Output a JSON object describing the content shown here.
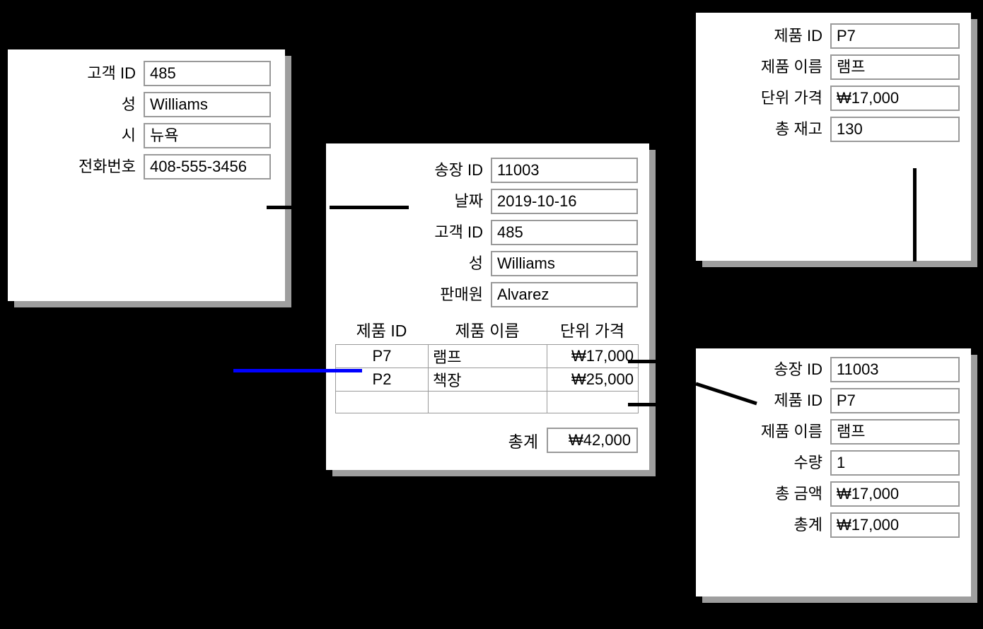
{
  "diagram": {
    "title": "Invoice relational card diagram",
    "background_color": "#000000",
    "card_color": "#ffffff",
    "shadow_color": "#9e9e9e",
    "input_border_color": "#999999",
    "connector_color": "#000000",
    "highlight_connector_color": "#0000ff"
  },
  "customer_card": {
    "name": "customer",
    "fields": [
      {
        "label": "고객 ID",
        "value": "485"
      },
      {
        "label": "성",
        "value": "Williams"
      },
      {
        "label": "시",
        "value": "뉴욕"
      },
      {
        "label": "전화번호",
        "value": "408-555-3456"
      }
    ]
  },
  "invoice_card": {
    "name": "invoice",
    "fields": [
      {
        "label": "송장 ID",
        "value": "11003"
      },
      {
        "label": "날짜",
        "value": "2019-10-16"
      },
      {
        "label": "고객 ID",
        "value": "485"
      },
      {
        "label": "성",
        "value": "Williams"
      },
      {
        "label": "판매원",
        "value": "Alvarez"
      }
    ],
    "items_table": {
      "columns": [
        "제품 ID",
        "제품 이름",
        "단위 가격"
      ],
      "rows": [
        {
          "product_id": "P7",
          "product_name": "램프",
          "unit_price": "₩17,000"
        },
        {
          "product_id": "P2",
          "product_name": "책장",
          "unit_price": "₩25,000"
        },
        {
          "product_id": "",
          "product_name": "",
          "unit_price": ""
        }
      ]
    },
    "total": {
      "label": "총계",
      "value": "₩42,000"
    }
  },
  "product_card": {
    "name": "product",
    "fields": [
      {
        "label": "제품 ID",
        "value": "P7"
      },
      {
        "label": "제품 이름",
        "value": "램프"
      },
      {
        "label": "단위 가격",
        "value": "₩17,000"
      },
      {
        "label": "총 재고",
        "value": "130"
      }
    ]
  },
  "line_item_card": {
    "name": "line-item",
    "fields": [
      {
        "label": "송장 ID",
        "value": "11003"
      },
      {
        "label": "제품 ID",
        "value": "P7"
      },
      {
        "label": "제품 이름",
        "value": "램프"
      },
      {
        "label": "수량",
        "value": "1"
      },
      {
        "label": "총 금액",
        "value": "₩17,000"
      },
      {
        "label": "총계",
        "value": "₩17,000"
      }
    ]
  },
  "connectors": [
    {
      "name": "customer-to-invoice",
      "color": "#000000"
    },
    {
      "name": "invoice-item-to-product",
      "color": "#000000"
    },
    {
      "name": "invoice-item-to-line-item",
      "color": "#000000"
    },
    {
      "name": "product-to-line-item",
      "color": "#000000"
    },
    {
      "name": "line-item-highlight",
      "color": "#0000ff"
    }
  ]
}
